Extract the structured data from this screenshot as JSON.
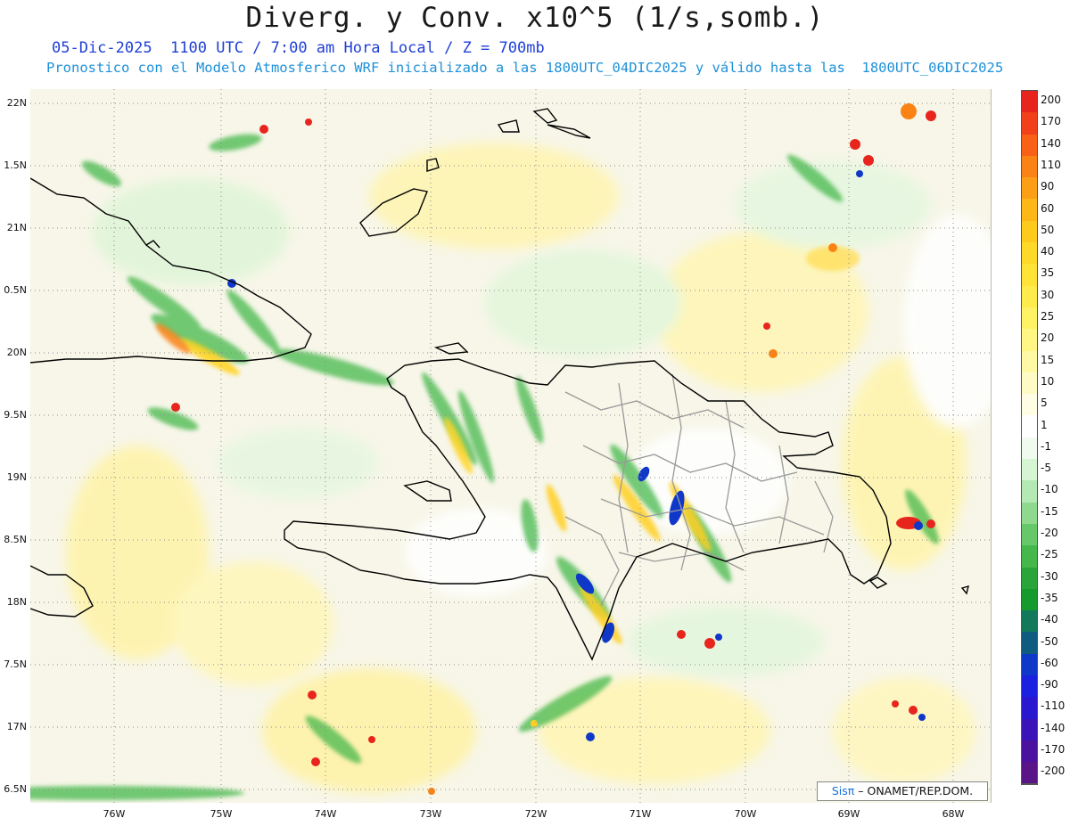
{
  "header": {
    "title": "Diverg. y Conv. x10^5 (1/s,somb.)",
    "subtitle_line1": "05-Dic-2025  1100 UTC / 7:00 am Hora Local / Z = 700mb",
    "subtitle_line2": "Pronostico con el Modelo Atmosferico WRF inicializado a las 1800UTC_04DIC2025 y válido hasta las  1800UTC_06DIC2025"
  },
  "map": {
    "lat_labels": [
      "22N",
      "1.5N",
      "21N",
      "0.5N",
      "20N",
      "9.5N",
      "19N",
      "8.5N",
      "18N",
      "7.5N",
      "17N",
      "6.5N"
    ],
    "lon_labels": [
      "76W",
      "75W",
      "74W",
      "73W",
      "72W",
      "71W",
      "70W",
      "69W",
      "68W"
    ],
    "field_colors": {
      "land_outline": "#000000",
      "province_lines": "#9a9a9a",
      "grid_lines": "#9a9a9a",
      "weak_convergence": "#d6f5d2",
      "moderate_convergence": "#45b84c",
      "weak_divergence": "#fff6b0",
      "moderate_divergence": "#ffcf22",
      "strong_divergence": "#e8251c",
      "strong_convergence": "#1038c8"
    }
  },
  "credit": {
    "brand": "Sisπ",
    "text": " – ONAMET/REP.DOM."
  },
  "colorbar": {
    "labels": [
      "200",
      "170",
      "140",
      "110",
      "90",
      "60",
      "50",
      "40",
      "35",
      "30",
      "25",
      "20",
      "15",
      "10",
      "5",
      "1",
      "-1",
      "-5",
      "-10",
      "-15",
      "-20",
      "-25",
      "-30",
      "-35",
      "-40",
      "-50",
      "-60",
      "-90",
      "-110",
      "-140",
      "-170",
      "-200"
    ],
    "colors": [
      "#e8251c",
      "#f2401a",
      "#f86116",
      "#fb8215",
      "#fc9f16",
      "#fdb818",
      "#fecb1d",
      "#ffd928",
      "#ffe437",
      "#ffec4c",
      "#fff264",
      "#fff684",
      "#fff9a6",
      "#fffbc6",
      "#fffde3",
      "#ffffff",
      "#f0faee",
      "#d6f5d2",
      "#b4e9b3",
      "#8fd98e",
      "#67c86a",
      "#45b84c",
      "#2aa53a",
      "#159a2e",
      "#127a5a",
      "#0f5c80",
      "#1038c8",
      "#1a22e0",
      "#2a18d0",
      "#3a14b8",
      "#4a129e",
      "#5a1488"
    ]
  }
}
